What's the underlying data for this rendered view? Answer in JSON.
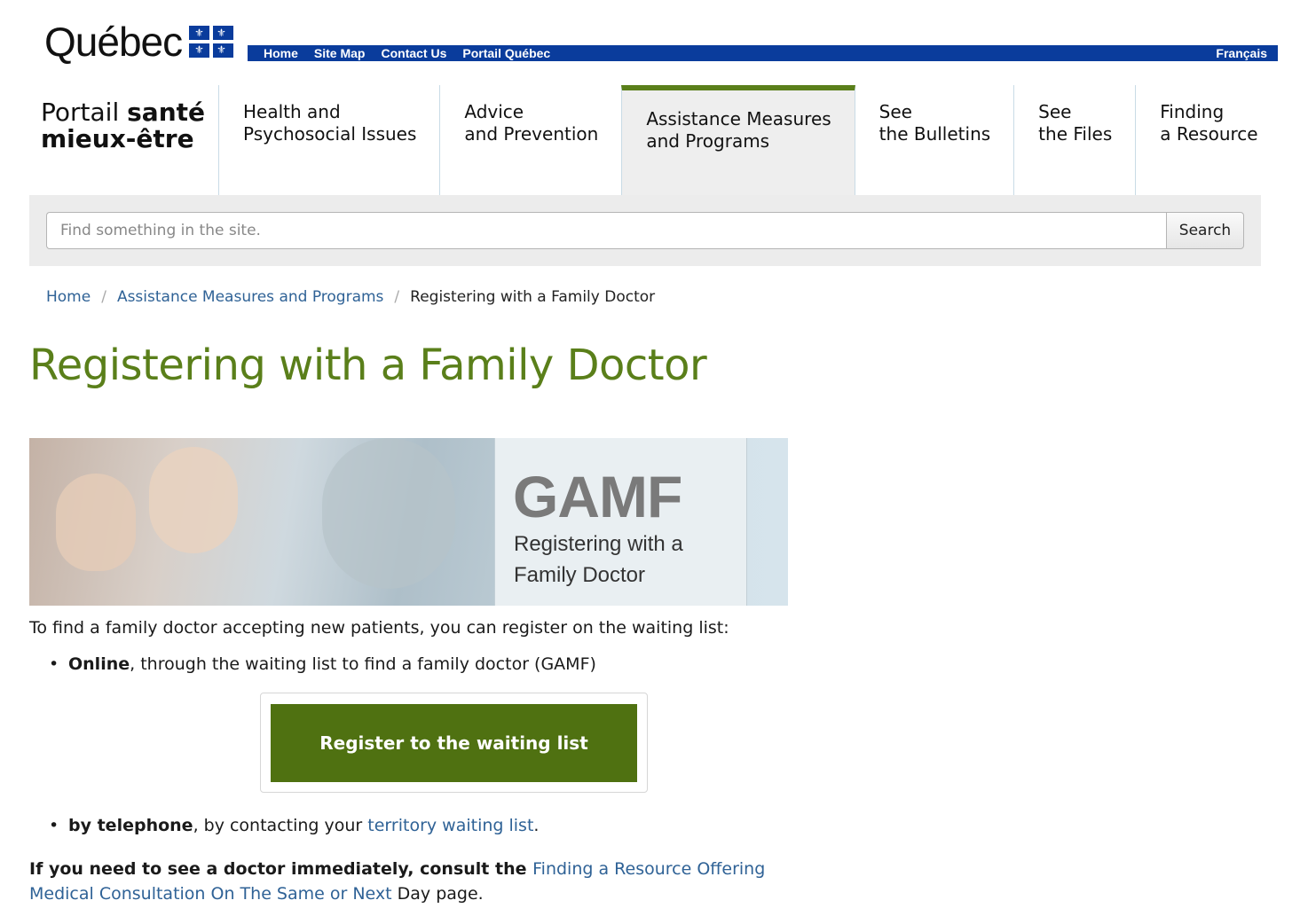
{
  "brand": {
    "logo_text": "Québec"
  },
  "topnav": {
    "links": [
      "Home",
      "Site Map",
      "Contact Us",
      "Portail Québec"
    ],
    "language": "Français"
  },
  "portal": {
    "line1_light": "Portail",
    "line1_bold": "santé",
    "line2": "mieux-être"
  },
  "mainnav": [
    {
      "line1": "Health and",
      "line2": "Psychosocial Issues"
    },
    {
      "line1": "Advice",
      "line2": "and Prevention"
    },
    {
      "line1": "Assistance Measures",
      "line2": "and Programs",
      "active": true
    },
    {
      "line1": "See",
      "line2": "the Bulletins"
    },
    {
      "line1": "See",
      "line2": "the Files"
    },
    {
      "line1": "Finding",
      "line2": "a Resource"
    }
  ],
  "search": {
    "placeholder": "Find something in the site.",
    "button": "Search"
  },
  "breadcrumb": {
    "home": "Home",
    "section": "Assistance Measures and Programs",
    "current": "Registering with a Family Doctor"
  },
  "page": {
    "title": "Registering with a Family Doctor",
    "banner": {
      "heading": "GAMF",
      "line1": "Registering with a",
      "line2": "Family Doctor"
    },
    "intro": "To find a family doctor accepting new patients, you can register on the waiting list:",
    "bullet_online": {
      "bold": "Online",
      "rest": ", through the waiting list to find a family doctor (GAMF)"
    },
    "register_button": "Register to the waiting list",
    "bullet_phone": {
      "bold": "by telephone",
      "pre_link": ", by contacting your ",
      "link": "territory waiting list",
      "post_link": "."
    },
    "final": {
      "bold": "If you need to see a doctor immediately, consult the ",
      "link": "Finding a Resource Offering Medical Consultation On The Same or Next",
      "rest": " Day page."
    }
  },
  "colors": {
    "brand_blue": "#0a3c9c",
    "accent_green": "#5a7f1a",
    "button_green": "#4f7111",
    "link_blue": "#2f6296"
  }
}
